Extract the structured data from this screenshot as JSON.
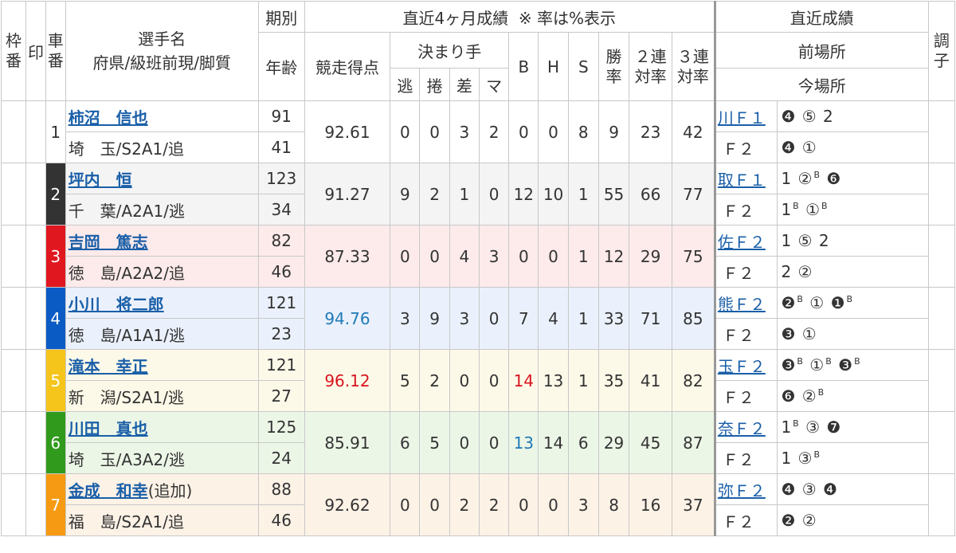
{
  "headers": {
    "waku": "枠番",
    "shirushi": "印",
    "sha": "車番",
    "sensyu": "選手名",
    "sensyu_sub": "府県/級班前現/脚質",
    "kibetsu": "期別",
    "nenrei": "年齢",
    "recent4": "直近4ヶ月成績  ※ 率は%表示",
    "score": "競走得点",
    "kimarite": "決まり手",
    "nige": "逃",
    "makuri": "捲",
    "sashi": "差",
    "mark": "マ",
    "b": "B",
    "h": "H",
    "s": "S",
    "win": "勝率",
    "ren2": "２連対率",
    "ren3": "３連対率",
    "recent": "直近成績",
    "prev": "前場所",
    "now": "今場所",
    "chosi": "調子"
  },
  "colors": {
    "car1": "#ffffff",
    "car2": "#333333",
    "car3": "#e0171f",
    "car4": "#0b5bc4",
    "car5": "#f5c51b",
    "car6": "#2f9a1c",
    "car7": "#f59a12",
    "link": "#1a5fa8",
    "highlight_blue": "#1f7ab8",
    "highlight_red": "#d9141e"
  },
  "riders": [
    {
      "car": "1",
      "name": "柿沼　信也",
      "name_extra": "",
      "pref": "埼　玉/S2A1/追",
      "ki": "91",
      "age": "41",
      "score": "92.61",
      "nige": "0",
      "makuri": "0",
      "sashi": "3",
      "mark": "2",
      "b": "0",
      "h": "0",
      "s": "8",
      "win": "9",
      "ren2": "23",
      "ren3": "42",
      "prev_place": "川Ｆ１",
      "prev_res": [
        {
          "t": "❹"
        },
        {
          "t": "⑤"
        },
        {
          "t": "2"
        }
      ],
      "now_place": "Ｆ２",
      "now_res": [
        {
          "t": "❹"
        },
        {
          "t": "①"
        }
      ]
    },
    {
      "car": "2",
      "name": "坪内　恒",
      "name_extra": "",
      "pref": "千　葉/A2A1/逃",
      "ki": "123",
      "age": "34",
      "score": "91.27",
      "nige": "9",
      "makuri": "2",
      "sashi": "1",
      "mark": "0",
      "b": "12",
      "h": "10",
      "s": "1",
      "win": "55",
      "ren2": "66",
      "ren3": "77",
      "prev_place": "取Ｆ１",
      "prev_res": [
        {
          "t": "1"
        },
        {
          "t": "②",
          "sup": "B"
        },
        {
          "t": "❻"
        }
      ],
      "now_place": "Ｆ２",
      "now_res": [
        {
          "t": "1",
          "sup": "B"
        },
        {
          "t": "①",
          "sup": "B"
        }
      ]
    },
    {
      "car": "3",
      "name": "吉岡　篤志",
      "name_extra": "",
      "pref": "徳　島/A2A2/追",
      "ki": "82",
      "age": "46",
      "score": "87.33",
      "nige": "0",
      "makuri": "0",
      "sashi": "4",
      "mark": "3",
      "b": "0",
      "h": "0",
      "s": "1",
      "win": "12",
      "ren2": "29",
      "ren3": "75",
      "prev_place": "佐Ｆ２",
      "prev_res": [
        {
          "t": "1"
        },
        {
          "t": "⑤"
        },
        {
          "t": "2"
        }
      ],
      "now_place": "Ｆ２",
      "now_res": [
        {
          "t": "2"
        },
        {
          "t": "②"
        }
      ]
    },
    {
      "car": "4",
      "name": "小川　将二郎",
      "name_extra": "",
      "pref": "徳　島/A1A1/逃",
      "ki": "121",
      "age": "23",
      "score": "94.76",
      "nige": "3",
      "makuri": "9",
      "sashi": "3",
      "mark": "0",
      "b": "7",
      "h": "4",
      "s": "1",
      "win": "33",
      "ren2": "71",
      "ren3": "85",
      "prev_place": "熊Ｆ２",
      "prev_res": [
        {
          "t": "❷",
          "sup": "B"
        },
        {
          "t": "①"
        },
        {
          "t": "❶",
          "sup": "B"
        }
      ],
      "now_place": "Ｆ２",
      "now_res": [
        {
          "t": "❸"
        },
        {
          "t": "①"
        }
      ]
    },
    {
      "car": "5",
      "name": "滝本　幸正",
      "name_extra": "",
      "pref": "新　潟/S2A1/逃",
      "ki": "121",
      "age": "27",
      "score": "96.12",
      "nige": "5",
      "makuri": "2",
      "sashi": "0",
      "mark": "0",
      "b": "14",
      "h": "13",
      "s": "1",
      "win": "35",
      "ren2": "41",
      "ren3": "82",
      "prev_place": "玉Ｆ２",
      "prev_res": [
        {
          "t": "❸",
          "sup": "B"
        },
        {
          "t": "①",
          "sup": "B"
        },
        {
          "t": "❸",
          "sup": "B"
        }
      ],
      "now_place": "Ｆ２",
      "now_res": [
        {
          "t": "❻"
        },
        {
          "t": "②",
          "sup": "B"
        }
      ]
    },
    {
      "car": "6",
      "name": "川田　真也",
      "name_extra": "",
      "pref": "埼　玉/A3A2/逃",
      "ki": "125",
      "age": "24",
      "score": "85.91",
      "nige": "6",
      "makuri": "5",
      "sashi": "0",
      "mark": "0",
      "b": "13",
      "h": "14",
      "s": "6",
      "win": "29",
      "ren2": "45",
      "ren3": "87",
      "prev_place": "奈Ｆ２",
      "prev_res": [
        {
          "t": "1",
          "sup": "B"
        },
        {
          "t": "③"
        },
        {
          "t": "❼"
        }
      ],
      "now_place": "Ｆ２",
      "now_res": [
        {
          "t": "1"
        },
        {
          "t": "③",
          "sup": "B"
        }
      ]
    },
    {
      "car": "7",
      "name": "金成　和幸",
      "name_extra": "(追加)",
      "pref": "福　島/S2A1/追",
      "ki": "88",
      "age": "46",
      "score": "92.62",
      "nige": "0",
      "makuri": "0",
      "sashi": "2",
      "mark": "2",
      "b": "0",
      "h": "0",
      "s": "3",
      "win": "8",
      "ren2": "16",
      "ren3": "37",
      "prev_place": "弥Ｆ２",
      "prev_res": [
        {
          "t": "❹"
        },
        {
          "t": "③"
        },
        {
          "t": "❹"
        }
      ],
      "now_place": "Ｆ２",
      "now_res": [
        {
          "t": "❷"
        },
        {
          "t": "②"
        }
      ]
    }
  ]
}
